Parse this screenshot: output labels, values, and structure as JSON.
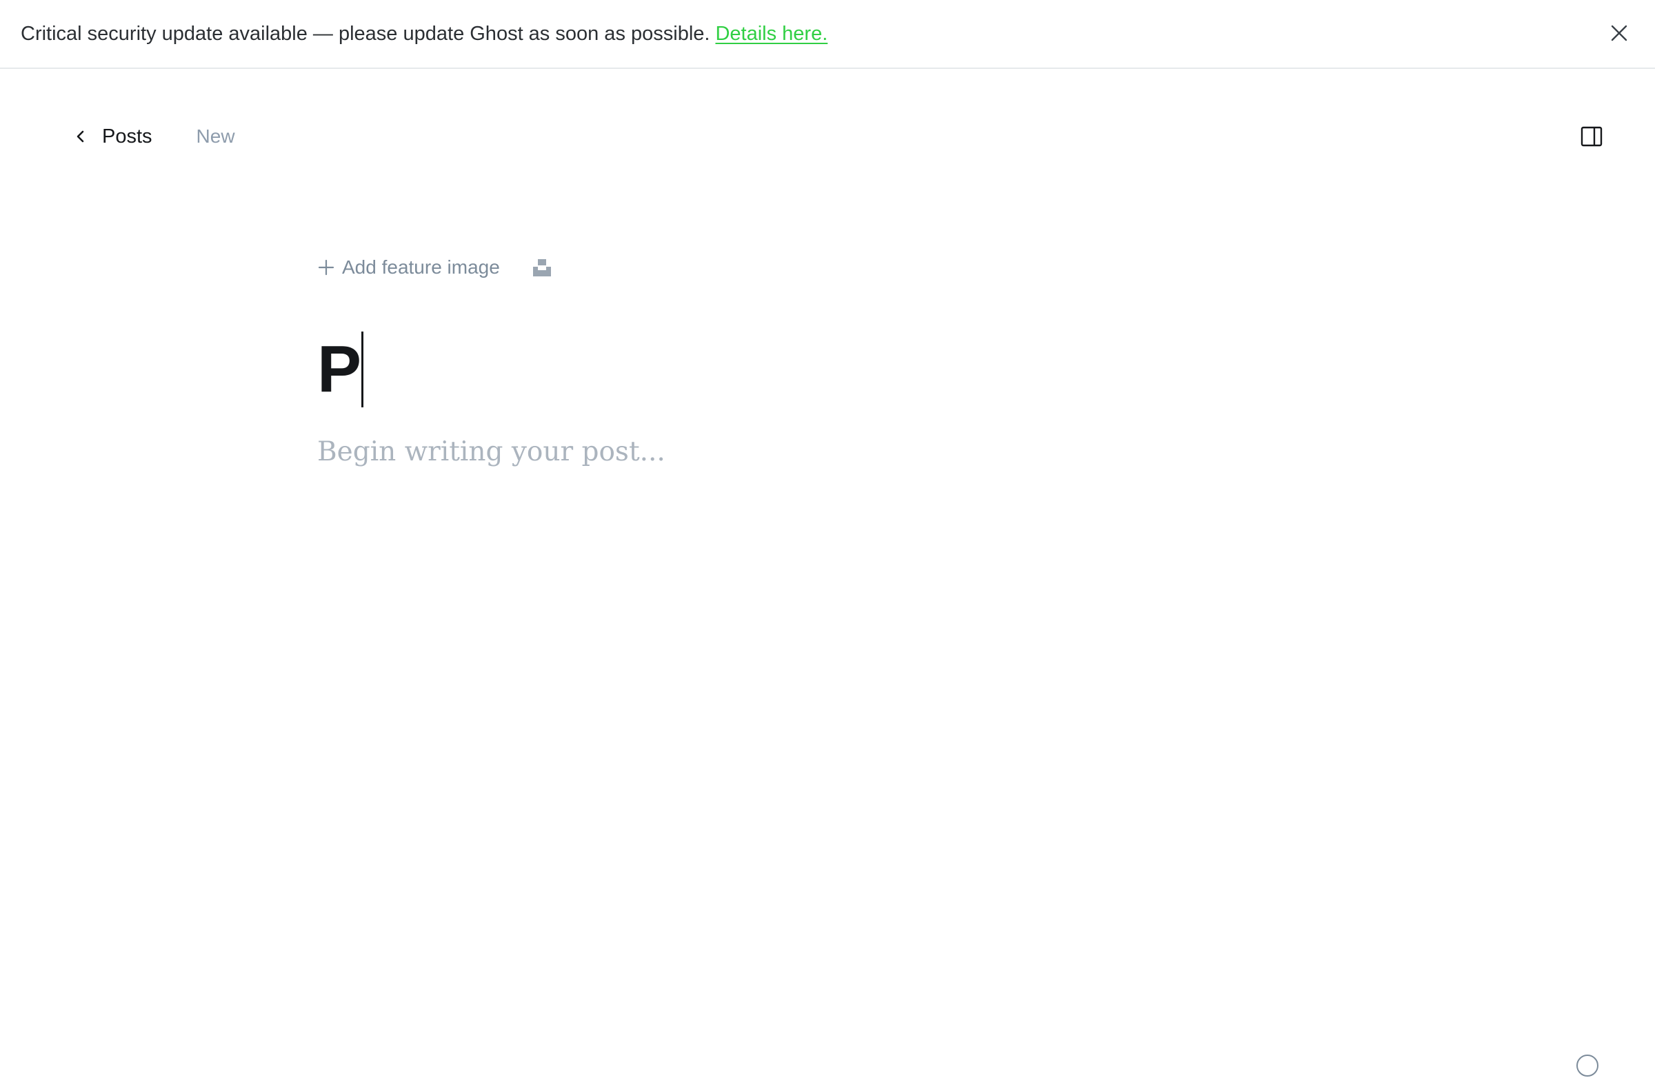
{
  "banner": {
    "message": "Critical security update available — please update Ghost as soon as possible.",
    "link_text": "Details here.",
    "link_color": "#30cf43",
    "close_icon": "close-icon"
  },
  "header": {
    "back_label": "Posts",
    "back_icon": "chevron-left-icon",
    "status": "New",
    "sidebar_icon": "sidebar-toggle-icon"
  },
  "editor": {
    "add_feature_image_label": "Add feature image",
    "add_feature_icon": "plus-icon",
    "unsplash_icon": "unsplash-icon",
    "title_value": "P",
    "body_placeholder": "Begin writing your post..."
  },
  "footer": {
    "help_icon": "help-icon"
  }
}
